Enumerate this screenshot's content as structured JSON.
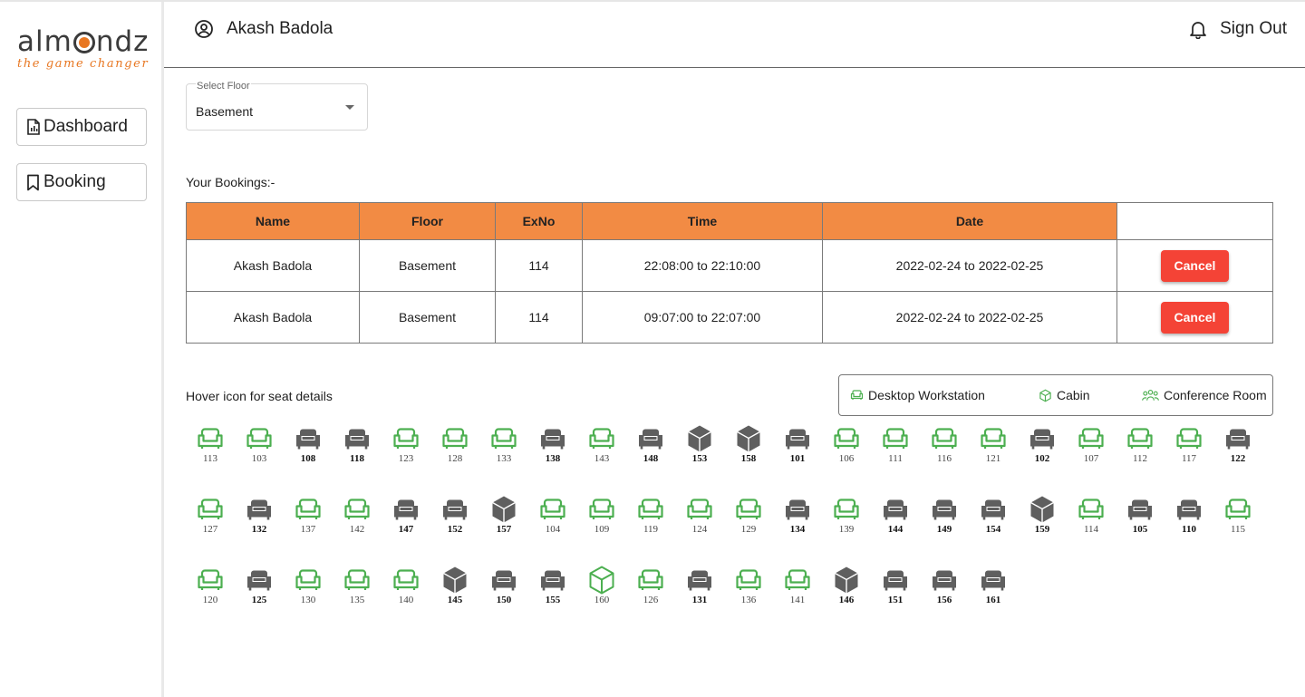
{
  "brand": {
    "word_left": "alm",
    "word_right": "ndz",
    "tagline": "the game changer",
    "accent": "#e87722"
  },
  "sidebar": {
    "items": [
      {
        "label": "Dashboard",
        "icon": "report-file-icon"
      },
      {
        "label": "Booking",
        "icon": "bookmark-icon"
      }
    ]
  },
  "header": {
    "user_name": "Akash Badola",
    "sign_out": "Sign Out"
  },
  "floor_select": {
    "label": "Select Floor",
    "value": "Basement"
  },
  "bookings": {
    "title": "Your Bookings:-",
    "columns": [
      "Name",
      "Floor",
      "ExNo",
      "Time",
      "Date"
    ],
    "rows": [
      {
        "name": "Akash Badola",
        "floor": "Basement",
        "exno": "114",
        "time": "22:08:00 to 22:10:00",
        "date": "2022-02-24 to 2022-02-25",
        "action": "Cancel"
      },
      {
        "name": "Akash Badola",
        "floor": "Basement",
        "exno": "114",
        "time": "09:07:00 to 22:07:00",
        "date": "2022-02-24 to 2022-02-25",
        "action": "Cancel"
      }
    ]
  },
  "seat_map": {
    "hint": "Hover icon for seat details",
    "legend": [
      {
        "label": "Desktop Workstation",
        "icon": "armchair-icon"
      },
      {
        "label": "Cabin",
        "icon": "cube-icon"
      },
      {
        "label": "Conference Room",
        "icon": "people-icon"
      }
    ],
    "colors": {
      "available": "#4caf50",
      "booked": "#5f5f5f"
    },
    "rows": [
      [
        {
          "n": "113",
          "t": "chair",
          "booked": false
        },
        {
          "n": "103",
          "t": "chair",
          "booked": false
        },
        {
          "n": "108",
          "t": "chair",
          "booked": true
        },
        {
          "n": "118",
          "t": "chair",
          "booked": true
        },
        {
          "n": "123",
          "t": "chair",
          "booked": false
        },
        {
          "n": "128",
          "t": "chair",
          "booked": false
        },
        {
          "n": "133",
          "t": "chair",
          "booked": false
        },
        {
          "n": "138",
          "t": "chair",
          "booked": true
        },
        {
          "n": "143",
          "t": "chair",
          "booked": false
        },
        {
          "n": "148",
          "t": "chair",
          "booked": true
        },
        {
          "n": "153",
          "t": "cube",
          "booked": true
        },
        {
          "n": "158",
          "t": "cube",
          "booked": true
        },
        {
          "n": "101",
          "t": "chair",
          "booked": true
        },
        {
          "n": "106",
          "t": "chair",
          "booked": false
        },
        {
          "n": "111",
          "t": "chair",
          "booked": false
        },
        {
          "n": "116",
          "t": "chair",
          "booked": false
        },
        {
          "n": "121",
          "t": "chair",
          "booked": false
        },
        {
          "n": "102",
          "t": "chair",
          "booked": true
        },
        {
          "n": "107",
          "t": "chair",
          "booked": false
        },
        {
          "n": "112",
          "t": "chair",
          "booked": false
        },
        {
          "n": "117",
          "t": "chair",
          "booked": false
        },
        {
          "n": "122",
          "t": "chair",
          "booked": true
        }
      ],
      [
        {
          "n": "127",
          "t": "chair",
          "booked": false
        },
        {
          "n": "132",
          "t": "chair",
          "booked": true
        },
        {
          "n": "137",
          "t": "chair",
          "booked": false
        },
        {
          "n": "142",
          "t": "chair",
          "booked": false
        },
        {
          "n": "147",
          "t": "chair",
          "booked": true
        },
        {
          "n": "152",
          "t": "chair",
          "booked": true
        },
        {
          "n": "157",
          "t": "cube",
          "booked": true
        },
        {
          "n": "104",
          "t": "chair",
          "booked": false
        },
        {
          "n": "109",
          "t": "chair",
          "booked": false
        },
        {
          "n": "119",
          "t": "chair",
          "booked": false
        },
        {
          "n": "124",
          "t": "chair",
          "booked": false
        },
        {
          "n": "129",
          "t": "chair",
          "booked": false
        },
        {
          "n": "134",
          "t": "chair",
          "booked": true
        },
        {
          "n": "139",
          "t": "chair",
          "booked": false
        },
        {
          "n": "144",
          "t": "chair",
          "booked": true
        },
        {
          "n": "149",
          "t": "chair",
          "booked": true
        },
        {
          "n": "154",
          "t": "chair",
          "booked": true
        },
        {
          "n": "159",
          "t": "cube",
          "booked": true
        },
        {
          "n": "114",
          "t": "chair",
          "booked": false
        },
        {
          "n": "105",
          "t": "chair",
          "booked": true
        },
        {
          "n": "110",
          "t": "chair",
          "booked": true
        },
        {
          "n": "115",
          "t": "chair",
          "booked": false
        }
      ],
      [
        {
          "n": "120",
          "t": "chair",
          "booked": false
        },
        {
          "n": "125",
          "t": "chair",
          "booked": true
        },
        {
          "n": "130",
          "t": "chair",
          "booked": false
        },
        {
          "n": "135",
          "t": "chair",
          "booked": false
        },
        {
          "n": "140",
          "t": "chair",
          "booked": false
        },
        {
          "n": "145",
          "t": "cube",
          "booked": true
        },
        {
          "n": "150",
          "t": "chair",
          "booked": true
        },
        {
          "n": "155",
          "t": "chair",
          "booked": true
        },
        {
          "n": "160",
          "t": "cube",
          "booked": false
        },
        {
          "n": "126",
          "t": "chair",
          "booked": false
        },
        {
          "n": "131",
          "t": "chair",
          "booked": true
        },
        {
          "n": "136",
          "t": "chair",
          "booked": false
        },
        {
          "n": "141",
          "t": "chair",
          "booked": false
        },
        {
          "n": "146",
          "t": "cube",
          "booked": true
        },
        {
          "n": "151",
          "t": "chair",
          "booked": true
        },
        {
          "n": "156",
          "t": "chair",
          "booked": true
        },
        {
          "n": "161",
          "t": "chair",
          "booked": true
        }
      ]
    ]
  }
}
